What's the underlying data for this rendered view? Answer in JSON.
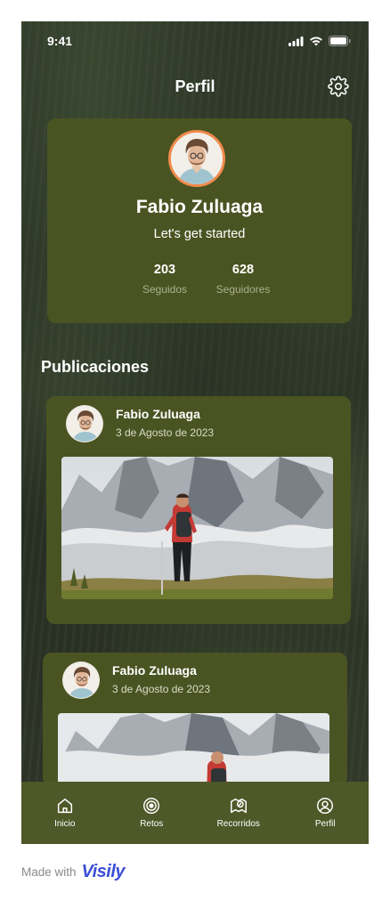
{
  "status_bar": {
    "time": "9:41"
  },
  "header": {
    "title": "Perfil"
  },
  "profile": {
    "name": "Fabio Zuluaga",
    "tagline": "Let's get started",
    "stats": [
      {
        "value": "203",
        "label": "Seguidos"
      },
      {
        "value": "628",
        "label": "Seguidores"
      }
    ]
  },
  "publications": {
    "title": "Publicaciones",
    "posts": [
      {
        "author": "Fabio Zuluaga",
        "date": "3 de Agosto de 2023"
      },
      {
        "author": "Fabio Zuluaga",
        "date": "3 de Agosto de 2023"
      }
    ]
  },
  "tabs": [
    {
      "label": "Inicio",
      "icon": "home-icon"
    },
    {
      "label": "Retos",
      "icon": "target-icon"
    },
    {
      "label": "Recorridos",
      "icon": "map-compass-icon"
    },
    {
      "label": "Perfil",
      "icon": "user-circle-icon"
    }
  ],
  "footer": {
    "made_with": "Made with",
    "brand": "Visily"
  },
  "colors": {
    "card": "#4a5422",
    "tab_bar": "#4e5828",
    "avatar_border": "#f08a4b",
    "brand": "#3d4fd6"
  }
}
